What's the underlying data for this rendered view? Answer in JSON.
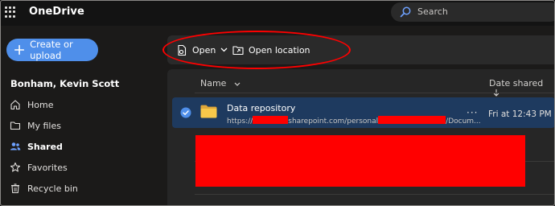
{
  "app": {
    "title": "OneDrive"
  },
  "search": {
    "placeholder": "Search"
  },
  "sidebar": {
    "create_label": "Create or upload",
    "user_name": "Bonham, Kevin Scott",
    "items": [
      {
        "label": "Home",
        "icon": "home-icon",
        "active": false
      },
      {
        "label": "My files",
        "icon": "folder-icon",
        "active": false
      },
      {
        "label": "Shared",
        "icon": "people-icon",
        "active": true
      },
      {
        "label": "Favorites",
        "icon": "star-icon",
        "active": false
      },
      {
        "label": "Recycle bin",
        "icon": "trash-icon",
        "active": false
      }
    ]
  },
  "commandbar": {
    "open_label": "Open",
    "open_location_label": "Open location"
  },
  "list": {
    "columns": {
      "name": "Name",
      "date": "Date shared"
    },
    "rows": [
      {
        "name": "Data repository",
        "path_part1": "https://",
        "path_part2": "sharepoint.com/personal",
        "path_part3": "/Docum...",
        "date": "Fri at 12:43 PM",
        "more": "···",
        "selected": true
      }
    ]
  },
  "colors": {
    "accent": "#4f8fea",
    "selection": "#1e3a5f",
    "annotation": "#ff0000",
    "folder": "#f8c84a"
  }
}
